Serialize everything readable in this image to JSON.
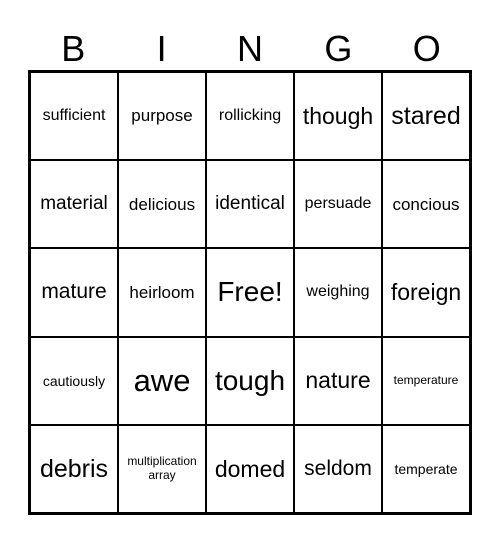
{
  "header": [
    "B",
    "I",
    "N",
    "G",
    "O"
  ],
  "cells": [
    [
      "sufficient",
      "purpose",
      "rollicking",
      "though",
      "stared"
    ],
    [
      "material",
      "delicious",
      "identical",
      "persuade",
      "concious"
    ],
    [
      "mature",
      "heirloom",
      "Free!",
      "weighing",
      "foreign"
    ],
    [
      "cautiously",
      "awe",
      "tough",
      "nature",
      "temperature"
    ],
    [
      "debris",
      "multiplication array",
      "domed",
      "seldom",
      "temperate"
    ]
  ]
}
